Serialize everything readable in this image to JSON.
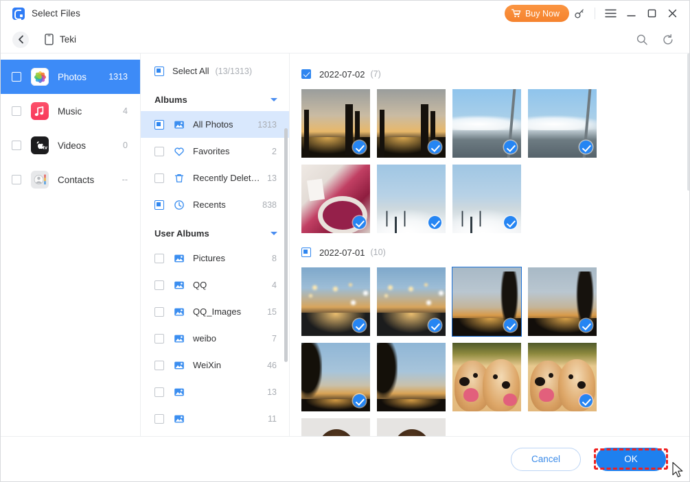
{
  "window": {
    "title": "Select Files",
    "logo_icon": "app-logo-icon",
    "buy_now": "Buy Now",
    "key_icon": "key-icon",
    "menu_icon": "hamburger-menu-icon",
    "minimize_icon": "minimize-icon",
    "maximize_icon": "maximize-icon",
    "close_icon": "close-icon"
  },
  "navbar": {
    "back_icon": "chevron-left-icon",
    "device_icon": "mobile-device-icon",
    "device_name": "Teki",
    "search_icon": "search-icon",
    "refresh_icon": "refresh-icon"
  },
  "categories": [
    {
      "label": "Photos",
      "count": "1313",
      "icon": "apple-photos-icon",
      "checked": false,
      "active": true
    },
    {
      "label": "Music",
      "count": "4",
      "icon": "apple-music-icon",
      "checked": false,
      "active": false
    },
    {
      "label": "Videos",
      "count": "0",
      "icon": "apple-tv-icon",
      "checked": false,
      "active": false
    },
    {
      "label": "Contacts",
      "count": "--",
      "icon": "apple-contacts-icon",
      "checked": false,
      "active": false
    }
  ],
  "albums_panel": {
    "select_all_label": "Select All",
    "select_all_count": "(13/1313)",
    "select_all_state": "indeterminate",
    "sections": [
      {
        "title": "Albums",
        "items": [
          {
            "name": "All Photos",
            "count": "1313",
            "icon": "photo-album-icon",
            "state": "indeterminate",
            "active": true,
            "blurred": false
          },
          {
            "name": "Favorites",
            "count": "2",
            "icon": "heart-icon",
            "state": "unchecked",
            "active": false,
            "blurred": false
          },
          {
            "name": "Recently Delet…",
            "count": "13",
            "icon": "trash-icon",
            "state": "unchecked",
            "active": false,
            "blurred": false
          },
          {
            "name": "Recents",
            "count": "838",
            "icon": "clock-icon",
            "state": "indeterminate",
            "active": false,
            "blurred": false
          }
        ]
      },
      {
        "title": "User Albums",
        "items": [
          {
            "name": "Pictures",
            "count": "8",
            "icon": "photo-album-icon",
            "state": "unchecked",
            "active": false,
            "blurred": false
          },
          {
            "name": "QQ",
            "count": "4",
            "icon": "photo-album-icon",
            "state": "unchecked",
            "active": false,
            "blurred": false
          },
          {
            "name": "QQ_Images",
            "count": "15",
            "icon": "photo-album-icon",
            "state": "unchecked",
            "active": false,
            "blurred": false
          },
          {
            "name": "weibo",
            "count": "7",
            "icon": "photo-album-icon",
            "state": "unchecked",
            "active": false,
            "blurred": false
          },
          {
            "name": "WeiXin",
            "count": "46",
            "icon": "photo-album-icon",
            "state": "unchecked",
            "active": false,
            "blurred": false
          },
          {
            "name": "",
            "count": "13",
            "icon": "photo-album-icon",
            "state": "unchecked",
            "active": false,
            "blurred": true
          },
          {
            "name": "",
            "count": "11",
            "icon": "photo-album-icon",
            "state": "unchecked",
            "active": false,
            "blurred": true
          }
        ]
      }
    ]
  },
  "photo_groups": [
    {
      "date": "2022-07-02",
      "count": "(7)",
      "state": "checked",
      "photos": [
        {
          "scene": "sc-sunsetcity",
          "selected": true,
          "focused": false
        },
        {
          "scene": "sc-sunsetcity",
          "selected": true,
          "focused": false
        },
        {
          "scene": "sc-mountain",
          "selected": true,
          "focused": false
        },
        {
          "scene": "sc-mountain",
          "selected": true,
          "focused": false
        },
        {
          "scene": "sc-pink",
          "selected": true,
          "focused": false
        },
        {
          "scene": "sc-lamp",
          "selected": true,
          "focused": false
        },
        {
          "scene": "sc-lamp",
          "selected": true,
          "focused": false
        }
      ]
    },
    {
      "date": "2022-07-01",
      "count": "(10)",
      "state": "indeterminate",
      "photos": [
        {
          "scene": "sc-street",
          "selected": true,
          "focused": false
        },
        {
          "scene": "sc-street",
          "selected": true,
          "focused": false
        },
        {
          "scene": "sc-tree",
          "selected": true,
          "focused": true
        },
        {
          "scene": "sc-tree",
          "selected": true,
          "focused": false
        },
        {
          "scene": "sc-treeleft",
          "selected": true,
          "focused": false
        },
        {
          "scene": "sc-treeleft",
          "selected": false,
          "focused": false
        },
        {
          "scene": "sc-dog",
          "selected": false,
          "focused": false
        },
        {
          "scene": "sc-dog",
          "selected": true,
          "focused": false
        },
        {
          "scene": "sc-hair",
          "selected": false,
          "focused": false
        },
        {
          "scene": "sc-hair",
          "selected": false,
          "focused": false
        }
      ]
    }
  ],
  "footer": {
    "cancel": "Cancel",
    "ok": "OK"
  },
  "colors": {
    "accent_blue": "#2f86f0",
    "active_row_blue": "#3d8bf7",
    "album_active_blue": "#d9e8fd",
    "buy_now_orange": "#f5822d",
    "ok_blue": "#1e80ef",
    "annotation_red": "#ef2020"
  }
}
